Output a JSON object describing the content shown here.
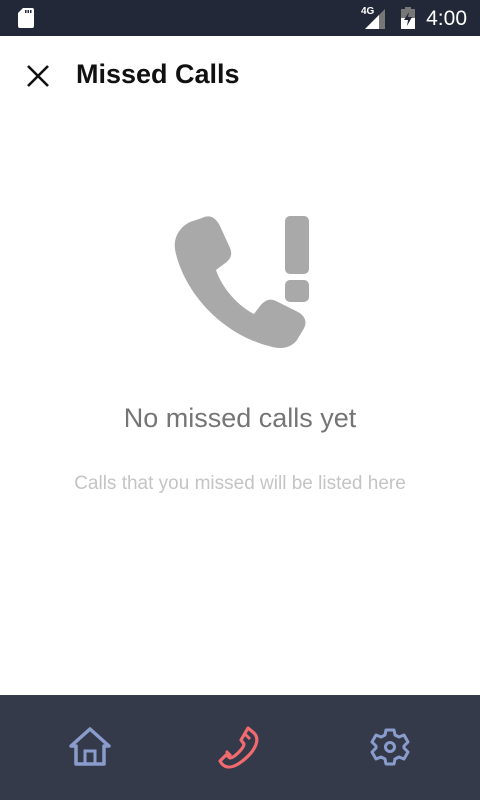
{
  "status_bar": {
    "time": "4:00",
    "network": "4G",
    "icons": [
      "sd-card-icon",
      "signal-icon",
      "battery-charging-icon"
    ]
  },
  "header": {
    "title": "Missed Calls",
    "close_icon": "close-icon"
  },
  "empty_state": {
    "icon": "missed-call-icon",
    "title": "No missed calls yet",
    "subtitle": "Calls that you missed will be listed here"
  },
  "bottom_nav": {
    "items": [
      {
        "name": "home",
        "icon": "home-icon",
        "active": false
      },
      {
        "name": "calls",
        "icon": "phone-icon",
        "active": true
      },
      {
        "name": "settings",
        "icon": "gear-icon",
        "active": false
      }
    ],
    "colors": {
      "inactive": "#8a9ccb",
      "active": "#f06a6e",
      "background": "#343a4a"
    }
  }
}
